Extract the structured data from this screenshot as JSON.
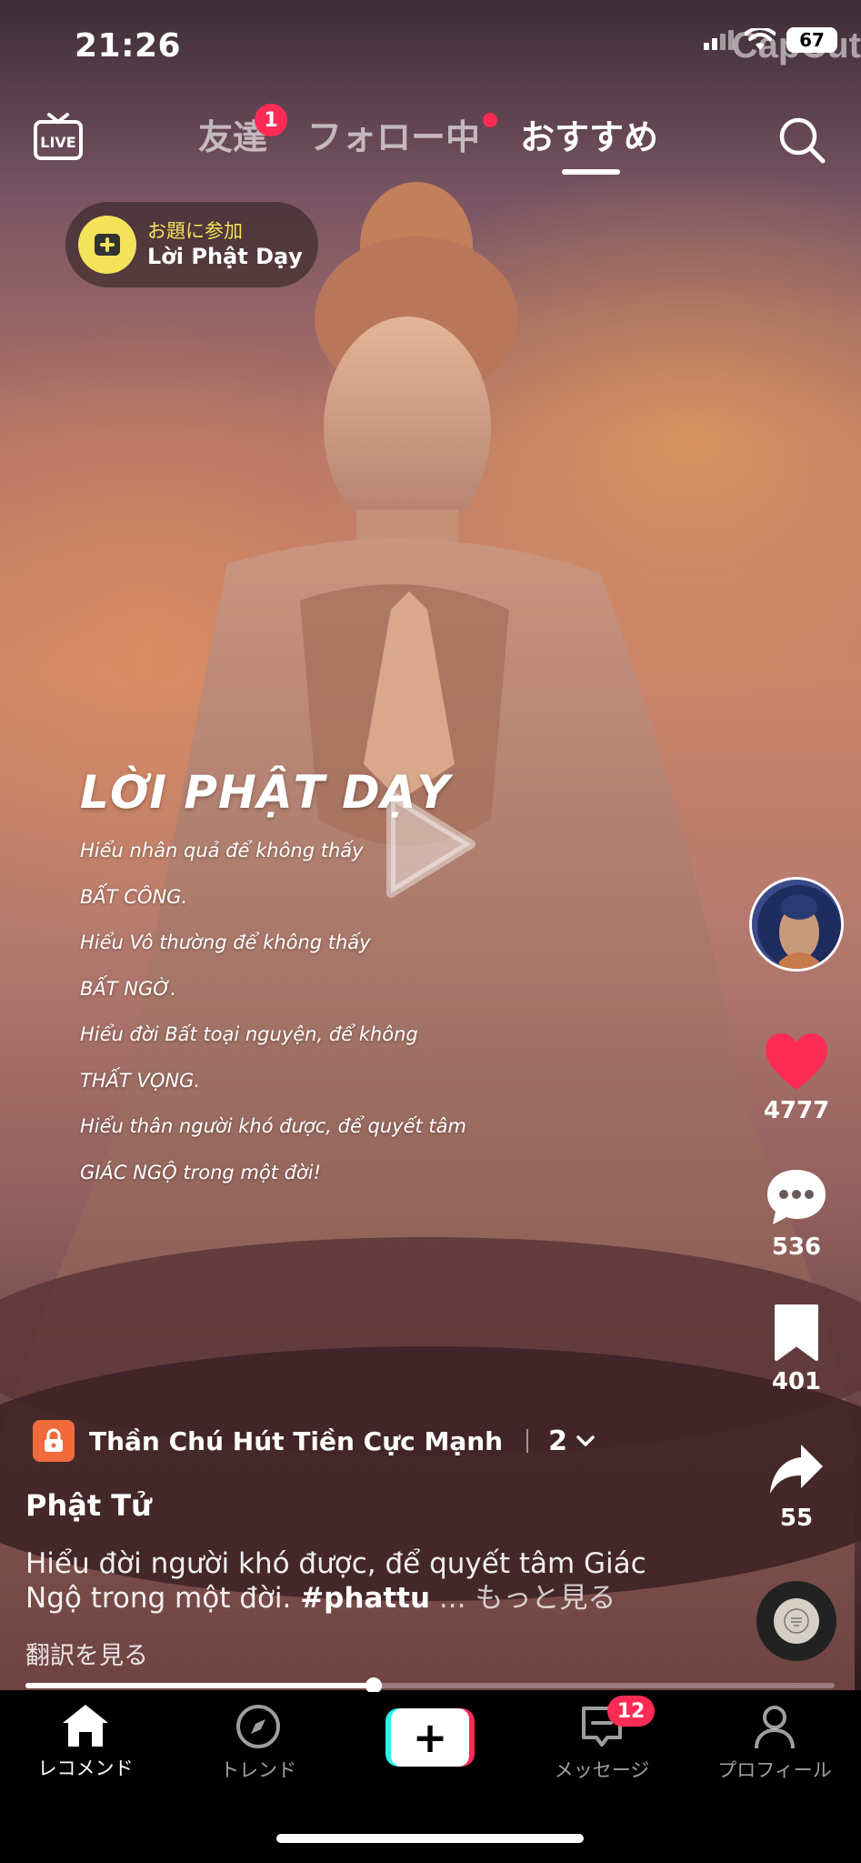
{
  "status_bar": {
    "time": "21:26",
    "battery": "67",
    "watermark": "CapCut"
  },
  "top_nav": {
    "live_label": "LIVE",
    "tabs": [
      {
        "label": "友達",
        "badge": "1"
      },
      {
        "label": "フォロー中",
        "dot": true
      },
      {
        "label": "おすすめ",
        "active": true
      }
    ]
  },
  "topic": {
    "label": "お題に参加",
    "name": "Lời Phật Dạy"
  },
  "overlay": {
    "title": "LỜI PHẬT DẠY",
    "lines": [
      "Hiểu nhân quả để không thấy",
      "BẤT CÔNG.",
      "Hiểu Vô thường để không thấy",
      "BẤT NGỜ.",
      "Hiểu đời Bất toại nguyện, để không",
      "THẤT VỌNG.",
      "Hiểu thân người khó được, để quyết tâm",
      "GIÁC NGỘ trong một đời!"
    ]
  },
  "rail": {
    "likes": "4777",
    "comments": "536",
    "saves": "401",
    "shares": "55"
  },
  "playlist": {
    "name": "Thần Chú Hút Tiền Cực Mạnh",
    "count": "2"
  },
  "post": {
    "author": "Phật Tử",
    "caption_text": "Hiểu đời người khó được, để quyết tâm Giác Ngộ trong một đời. ",
    "hashtag": "#phattu",
    "more": " ... もっと見る",
    "translate": "翻訳を見る"
  },
  "progress": {
    "fraction": 0.43
  },
  "tabbar": {
    "home": "レコメンド",
    "trend": "トレンド",
    "create": "+",
    "inbox": "メッセージ",
    "inbox_badge": "12",
    "profile": "プロフィール"
  },
  "colors": {
    "accent": "#fe2c55",
    "topic_yellow": "#f4e25a",
    "create_cyan": "#25f4ee"
  }
}
